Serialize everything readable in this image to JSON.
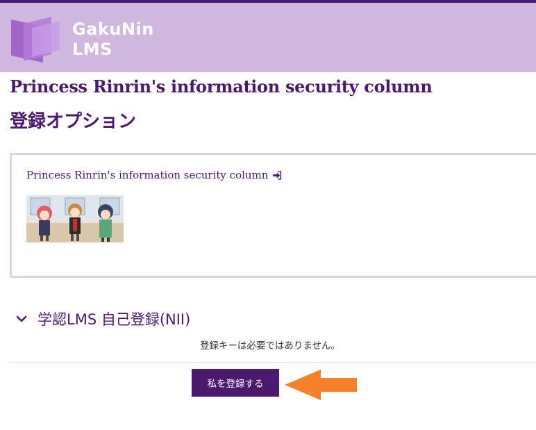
{
  "brand": {
    "name_line1": "GakuNin",
    "name_line2": "LMS",
    "colors": {
      "header_bg": "#d0b7de",
      "top_rule": "#4a1a6e",
      "accent": "#4a1a6e",
      "arrow": "#f5822a"
    }
  },
  "course": {
    "title": "Princess Rinrin's information security column",
    "link_label": "Princess Rinrin's information security column",
    "link_icon": "sign-in-icon"
  },
  "page": {
    "heading": "登録オプション"
  },
  "enrolment": {
    "section_title": "学認LMS 自己登録(NII)",
    "section_icon": "chevron-down-icon",
    "message": "登録キーは必要ではありません。",
    "button_label": "私を登録する"
  }
}
